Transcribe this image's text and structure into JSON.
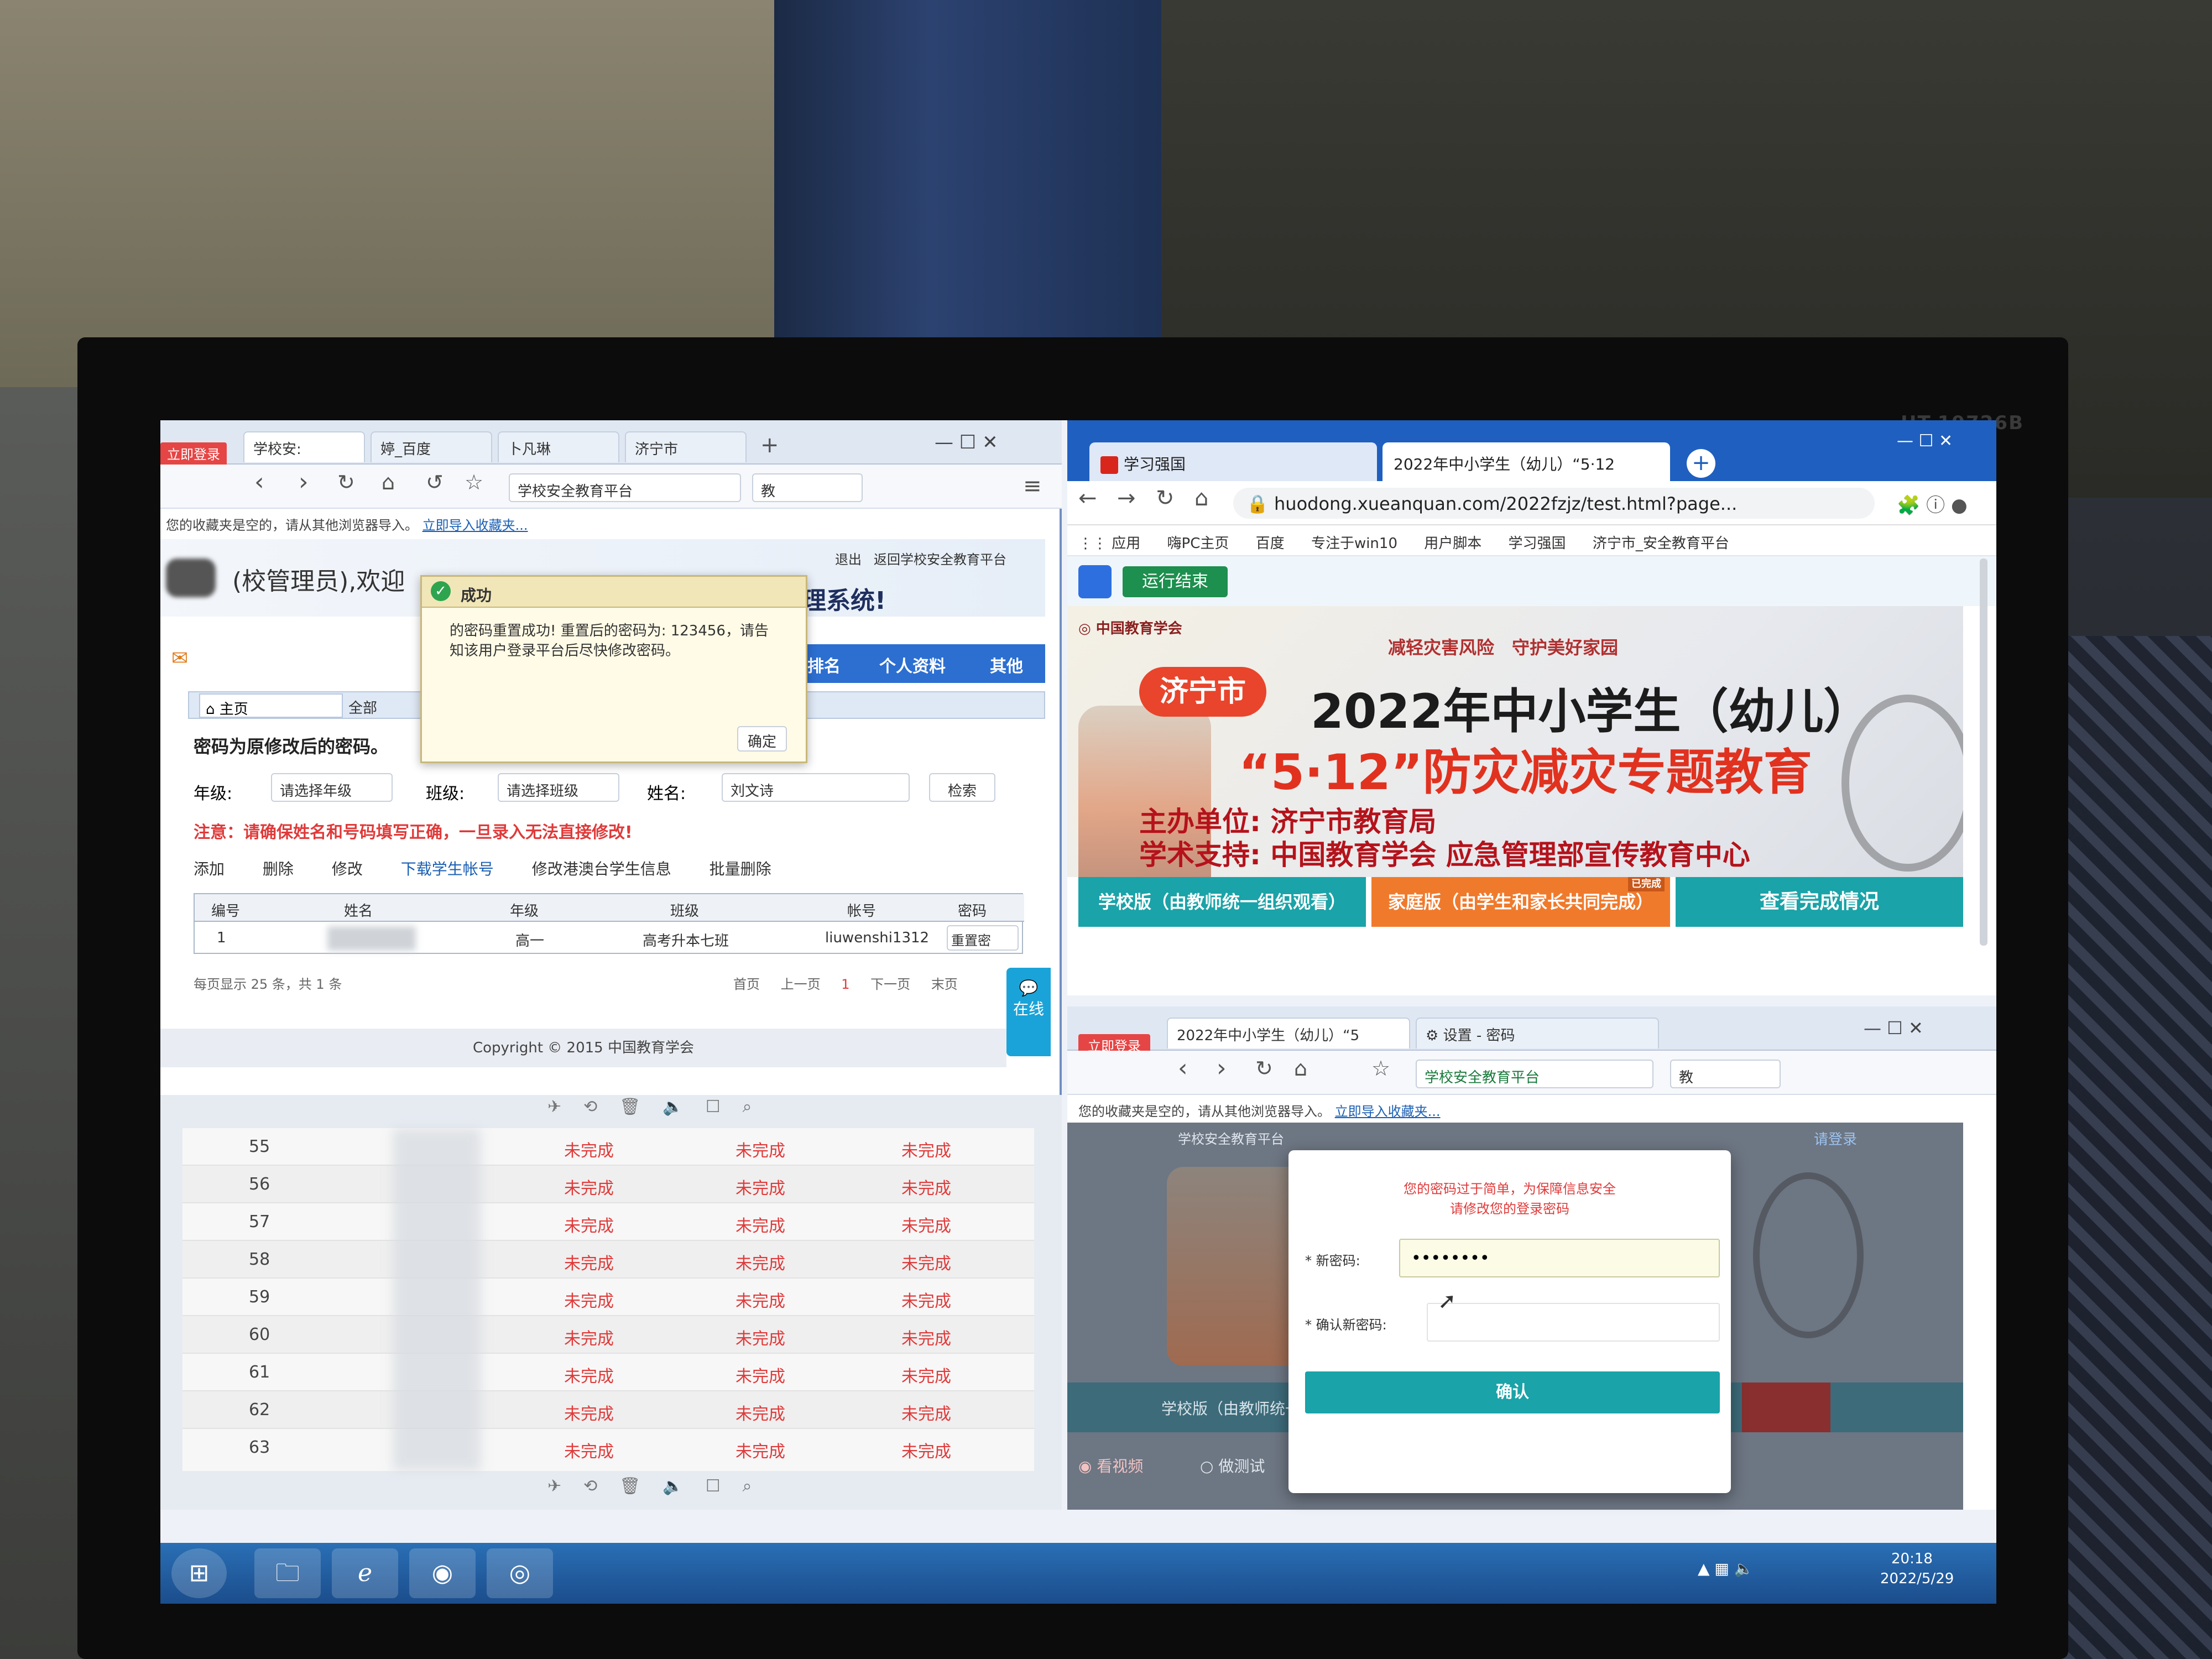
{
  "monitor": {
    "model": "HT-19726B"
  },
  "left_browser": {
    "badge": "立即登录",
    "tabs": [
      "学校安:",
      "婷_百度",
      "卜凡琳",
      "济宁市"
    ],
    "address": "学校安全教育平台",
    "search_label": "教",
    "bookmark_notice": "您的收藏夹是空的，请从其他浏览器导入。",
    "import_link": "立即导入收藏夹...",
    "greeting": "(校管理员),欢迎",
    "system_title": "理系统!",
    "return_link": "返回学校安全教育平台",
    "exit_link": "退出",
    "nav": [
      "排名",
      "个人资料",
      "其他"
    ],
    "home_tab": "主页",
    "all_tab": "全部",
    "section_title": "密码为原修改后的密码。",
    "filters": {
      "grade_label": "年级:",
      "grade_value": "请选择年级",
      "class_label": "班级:",
      "class_value": "请选择班级",
      "name_label": "姓名:",
      "name_value": "刘文诗",
      "search_button": "检索"
    },
    "warning": "注意：请确保姓名和号码填写正确，一旦录入无法直接修改!",
    "toolbar": [
      "添加",
      "删除",
      "修改",
      "下载学生帐号",
      "修改港澳台学生信息",
      "批量删除"
    ],
    "table": {
      "headers": [
        "编号",
        "姓名",
        "年级",
        "班级",
        "帐号",
        "密码"
      ],
      "rows": [
        {
          "no": "1",
          "name": "",
          "grade": "高一",
          "class": "高考升本七班",
          "account": "liuwenshi1312",
          "action": "重置密"
        }
      ]
    },
    "pager": {
      "summary": "每页显示 25 条，共 1 条",
      "first": "首页",
      "prev": "上一页",
      "page": "1",
      "next": "下一页",
      "last": "末页"
    },
    "dialog": {
      "title": "成功",
      "body": "的密码重置成功! 重置后的密码为: 123456，请告知该用户登录平台后尽快修改密码。",
      "ok": "确定"
    },
    "online_tab": "在线",
    "copyright": "Copyright © 2015 中国教育学会"
  },
  "progress_list": {
    "rows": [
      {
        "no": "55",
        "s1": "未完成",
        "s2": "未完成",
        "s3": "未完成"
      },
      {
        "no": "56",
        "s1": "未完成",
        "s2": "未完成",
        "s3": "未完成"
      },
      {
        "no": "57",
        "s1": "未完成",
        "s2": "未完成",
        "s3": "未完成"
      },
      {
        "no": "58",
        "s1": "未完成",
        "s2": "未完成",
        "s3": "未完成"
      },
      {
        "no": "59",
        "s1": "未完成",
        "s2": "未完成",
        "s3": "未完成"
      },
      {
        "no": "60",
        "s1": "未完成",
        "s2": "未完成",
        "s3": "未完成"
      },
      {
        "no": "61",
        "s1": "未完成",
        "s2": "未完成",
        "s3": "未完成"
      },
      {
        "no": "62",
        "s1": "未完成",
        "s2": "未完成",
        "s3": "未完成"
      },
      {
        "no": "63",
        "s1": "未完成",
        "s2": "未完成",
        "s3": "未完成"
      }
    ]
  },
  "right_browser": {
    "tabs": [
      "学习强国",
      "2022年中小学生（幼儿）“5·12"
    ],
    "url": "huodong.xueanquan.com/2022fzjz/test.html?page...",
    "bookmarks": [
      "应用",
      "嗨PC主页",
      "百度",
      "专注于win10",
      "用户脚本",
      "学习强国",
      "济宁市_安全教育平台"
    ],
    "run_end": "运行结束",
    "banner": {
      "org_logo": "中国教育学会",
      "slogan": "减轻灾害风险　守护美好家园",
      "city": "济宁市",
      "title_line1": "2022年中小学生（幼儿）",
      "title_line2": "“5·12”防灾减灾专题教育",
      "host": "主办单位: 济宁市教育局",
      "support": "学术支持: 中国教育学会 应急管理部宣传教育中心"
    },
    "buttons": {
      "school": "学校版（由教师统一组织观看）",
      "family": "家庭版（由学生和家长共同完成）",
      "family_badge": "已完成",
      "check": "查看完成情况"
    }
  },
  "lower_browser": {
    "badge": "立即登录",
    "tabs": [
      "2022年中小学生（幼儿）“5",
      "设置 - 密码"
    ],
    "address": "学校安全教育平台",
    "search_label": "教",
    "bookmark_notice": "您的收藏夹是空的，请从其他浏览器导入。",
    "import_link": "立即导入收藏夹...",
    "site_name": "学校安全教育平台",
    "login_link": "请登录",
    "modal": {
      "message_line1": "您的密码过于简单，为保障信息安全",
      "message_line2": "请修改您的登录密码",
      "new_label": "* 新密码:",
      "new_value": "••••••••",
      "confirm_label": "* 确认新密码:",
      "confirm_value": "",
      "submit": "确认"
    },
    "bg_school_btn": "学校版（由教师统一",
    "watch": "看视频",
    "test": "做测试"
  },
  "taskbar": {
    "time": "20:18",
    "date": "2022/5/29"
  }
}
